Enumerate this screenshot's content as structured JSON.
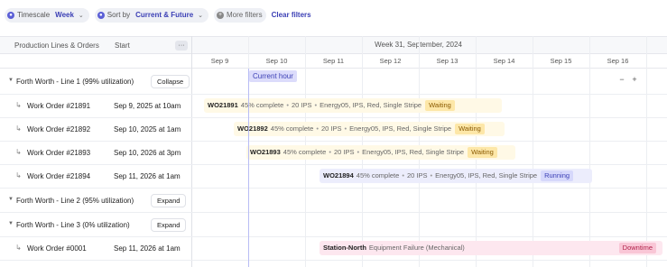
{
  "toolbar": {
    "timescale_label": "Timescale",
    "timescale_value": "Week",
    "sort_label": "Sort by",
    "sort_value": "Current & Future",
    "more_filters_label": "More filters",
    "clear_filters_label": "Clear filters"
  },
  "table_header": {
    "col_name": "Production Lines & Orders",
    "col_start": "Start",
    "more_button": "···"
  },
  "timeline": {
    "week_label": "Week 31, September, 2024",
    "days": [
      "Sep 9",
      "Sep 10",
      "Sep 11",
      "Sep 12",
      "Sep 13",
      "Sep 14",
      "Sep 15",
      "Sep 16"
    ],
    "current_hour_label": "Current hour",
    "zoom_out": "−",
    "zoom_in": "+"
  },
  "groups": [
    {
      "title": "Forth Worth - Line 1 (99% utilization)",
      "button": "Collapse"
    },
    {
      "title": "Forth Worth - Line 2 (95% utilization)",
      "button": "Expand"
    },
    {
      "title": "Forth Worth - Line 3 (0% utilization)",
      "button": "Expand"
    }
  ],
  "orders": [
    {
      "name": "Work Order #21891",
      "start": "Sep 9, 2025 at 10am",
      "code": "WO21891",
      "complete": "45% complete",
      "ips": "20 IPS",
      "spec": "Energy05, IPS, Red, Single Stripe",
      "status": "Waiting"
    },
    {
      "name": "Work Order #21892",
      "start": "Sep 10, 2025 at 1am",
      "code": "WO21892",
      "complete": "45% complete",
      "ips": "20 IPS",
      "spec": "Energy05, IPS, Red, Single Stripe",
      "status": "Waiting"
    },
    {
      "name": "Work Order #21893",
      "start": "Sep 10, 2026 at 3pm",
      "code": "WO21893",
      "complete": "45% complete",
      "ips": "20 IPS",
      "spec": "Energy05, IPS, Red, Single Stripe",
      "status": "Waiting"
    },
    {
      "name": "Work Order #21894",
      "start": "Sep 11, 2026 at 1am",
      "code": "WO21894",
      "complete": "45% complete",
      "ips": "20 IPS",
      "spec": "Energy05, IPS, Red, Single Stripe",
      "status": "Running"
    },
    {
      "name": "Work Order #0001",
      "start": "Sep 11, 2026 at 1am",
      "code": "Station-North",
      "detail": "Equipment Failure (Mechanical)",
      "status": "Downtime"
    }
  ],
  "colors": {
    "accent": "#3b3fb5",
    "waiting": "#fde7a8",
    "running": "#d6d8fb",
    "downtime": "#f9c6d6"
  }
}
